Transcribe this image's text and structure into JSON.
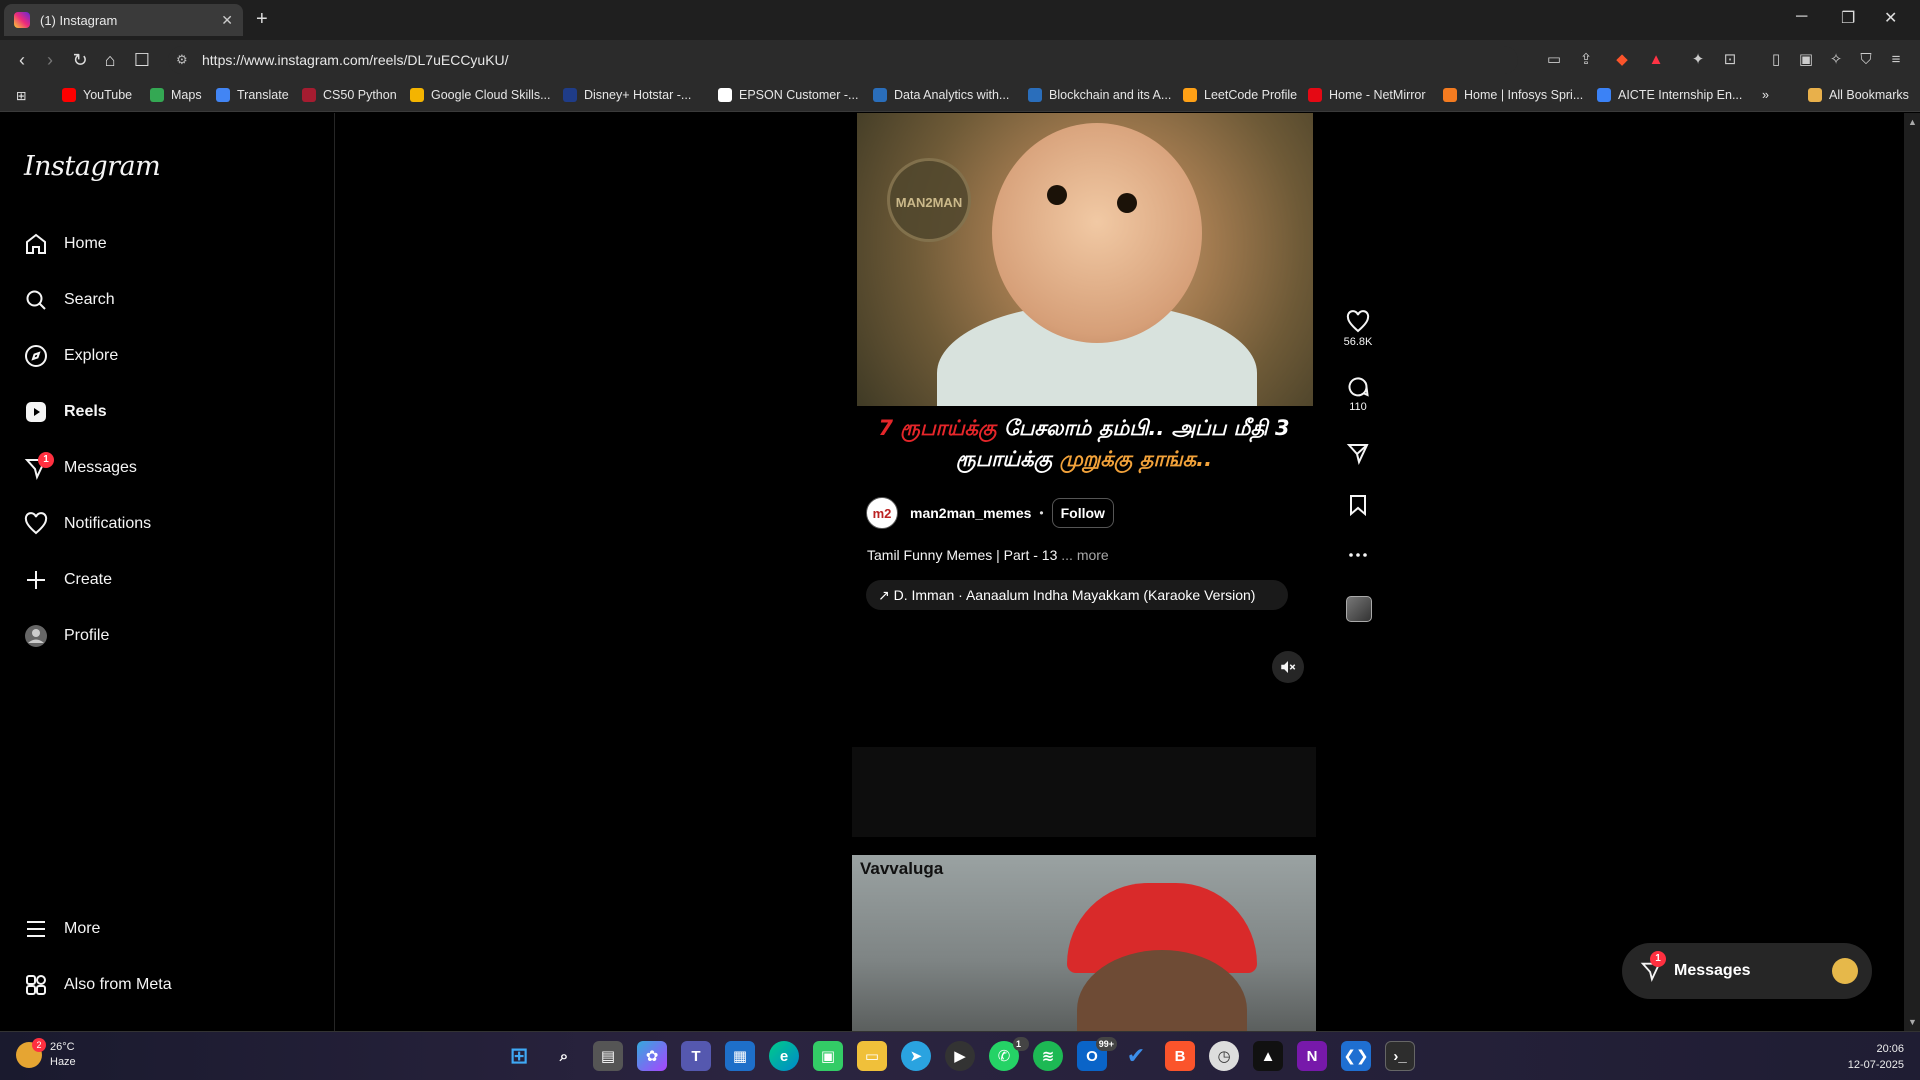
{
  "browser": {
    "tab_title": "(1) Instagram",
    "url": "https://www.instagram.com/reels/DL7uECCyuKU/",
    "bookmarks": [
      {
        "label": "YouTube",
        "color": "#ff0000"
      },
      {
        "label": "Maps",
        "color": "#34a853"
      },
      {
        "label": "Translate",
        "color": "#4285f4"
      },
      {
        "label": "CS50 Python",
        "color": "#a51c30"
      },
      {
        "label": "Google Cloud Skills...",
        "color": "#f4b400"
      },
      {
        "label": "Disney+ Hotstar -...",
        "color": "#1f3c88"
      },
      {
        "label": "EPSON Customer -...",
        "color": "#ffffff"
      },
      {
        "label": "Data Analytics with...",
        "color": "#2a6ebb"
      },
      {
        "label": "Blockchain and its A...",
        "color": "#2a6ebb"
      },
      {
        "label": "LeetCode Profile",
        "color": "#ffa116"
      },
      {
        "label": "Home - NetMirror",
        "color": "#e50914"
      },
      {
        "label": "Home | Infosys Spri...",
        "color": "#f47b20"
      },
      {
        "label": "AICTE Internship En...",
        "color": "#3b82f6"
      }
    ],
    "all_bookmarks": "All Bookmarks",
    "extension_badge": "5"
  },
  "sidebar": {
    "logo": "Instagram",
    "items": [
      {
        "label": "Home",
        "icon": "home-icon"
      },
      {
        "label": "Search",
        "icon": "search-icon"
      },
      {
        "label": "Explore",
        "icon": "compass-icon"
      },
      {
        "label": "Reels",
        "icon": "reels-icon"
      },
      {
        "label": "Messages",
        "icon": "messenger-icon",
        "badge": "1"
      },
      {
        "label": "Notifications",
        "icon": "heart-icon"
      },
      {
        "label": "Create",
        "icon": "plus-icon"
      },
      {
        "label": "Profile",
        "icon": "avatar-icon"
      }
    ],
    "more": "More",
    "meta": "Also from Meta"
  },
  "reel": {
    "logo_text": "MAN2MAN",
    "caption_part1": "7 ரூபாய்க்கு",
    "caption_part2": " பேசலாம் தம்பி.. அப்ப மீதி 3 ரூபாய்க்கு ",
    "caption_part3": "முறுக்கு தாங்க..",
    "username": "man2man_memes",
    "separator": "•",
    "follow": "Follow",
    "description": "Tamil Funny Memes | Part - 13",
    "more": " ... more",
    "audio": "↗ D. Imman · Aanaalum Indha Mayakkam (Karaoke Version)",
    "next_label": "Vavvaluga"
  },
  "actions": {
    "likes": "56.8K",
    "comments": "110"
  },
  "messages_float": {
    "label": "Messages",
    "badge": "1"
  },
  "taskbar": {
    "temperature": "26°C",
    "condition": "Haze",
    "weather_badge": "2",
    "whatsapp_badge": "1",
    "outlook_badge": "99+",
    "time": "20:06",
    "date": "12-07-2025"
  }
}
